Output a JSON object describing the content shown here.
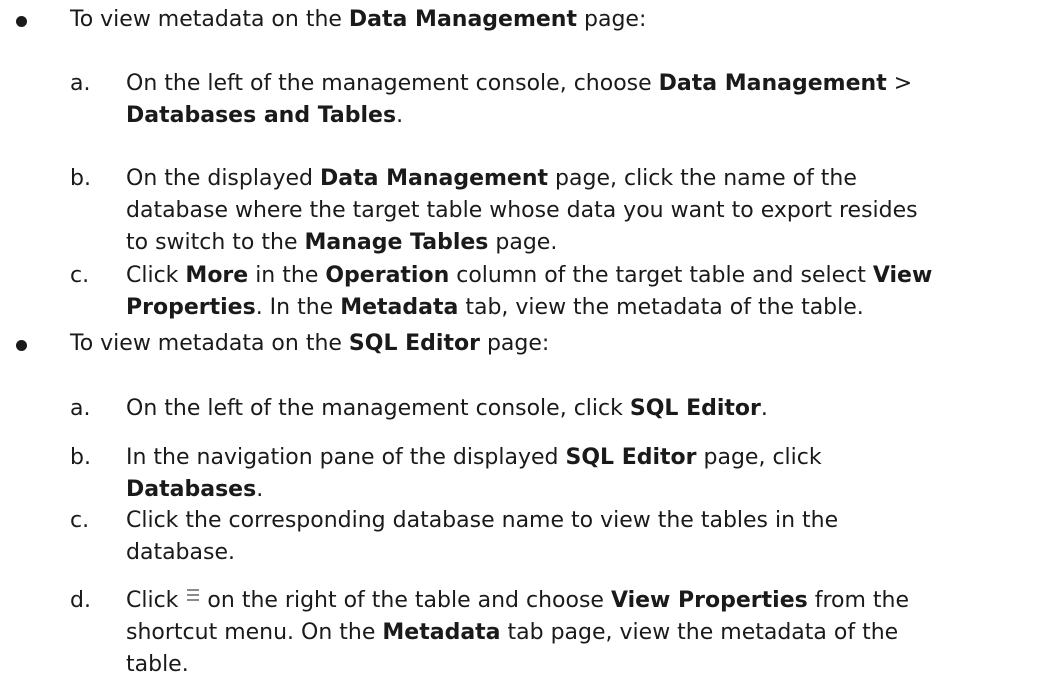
{
  "bullet1": {
    "pre": "To view metadata on the ",
    "bold": "Data Management",
    "post": " page:"
  },
  "list1": {
    "a": {
      "letter": "a.",
      "l1_pre": "On the left of the management console, choose ",
      "l1_bold": "Data Management",
      "l1_post": " >",
      "l2_bold": "Databases and Tables",
      "l2_post": "."
    },
    "b": {
      "letter": "b.",
      "l1_pre": "On the displayed ",
      "l1_bold": "Data Management",
      "l1_post": " page, click the name of the",
      "l2": "database where the target table whose data you want to export resides",
      "l3_pre": "to switch to the ",
      "l3_bold": "Manage Tables",
      "l3_post": " page."
    },
    "c": {
      "letter": "c.",
      "l1_pre": "Click ",
      "l1_bold1": "More",
      "l1_mid": " in the ",
      "l1_bold2": "Operation",
      "l1_mid2": " column of the target table and select ",
      "l1_bold3": "View",
      "l2_bold": "Properties",
      "l2_mid": ". In the ",
      "l2_bold2": "Metadata",
      "l2_post": " tab, view the metadata of the table."
    }
  },
  "bullet2": {
    "pre": "To view metadata on the ",
    "bold": "SQL Editor",
    "post": " page:"
  },
  "list2": {
    "a": {
      "letter": "a.",
      "l1_pre": "On the left of the management console, click ",
      "l1_bold": "SQL Editor",
      "l1_post": "."
    },
    "b": {
      "letter": "b.",
      "l1_pre": "In the navigation pane of the displayed ",
      "l1_bold": "SQL Editor",
      "l1_post": " page, click",
      "l2_bold": "Databases",
      "l2_post": "."
    },
    "c": {
      "letter": "c.",
      "l1": "Click the corresponding database name to view the tables in the",
      "l2": "database."
    },
    "d": {
      "letter": "d.",
      "l1_pre": "Click ",
      "icon": "menu-icon",
      "l1_mid": "on the right of the table and choose ",
      "l1_bold": "View Properties",
      "l1_post": " from the",
      "l2_pre": "shortcut menu. On the ",
      "l2_bold": "Metadata",
      "l2_post": " tab page, view the metadata of the",
      "l3": "table."
    }
  }
}
